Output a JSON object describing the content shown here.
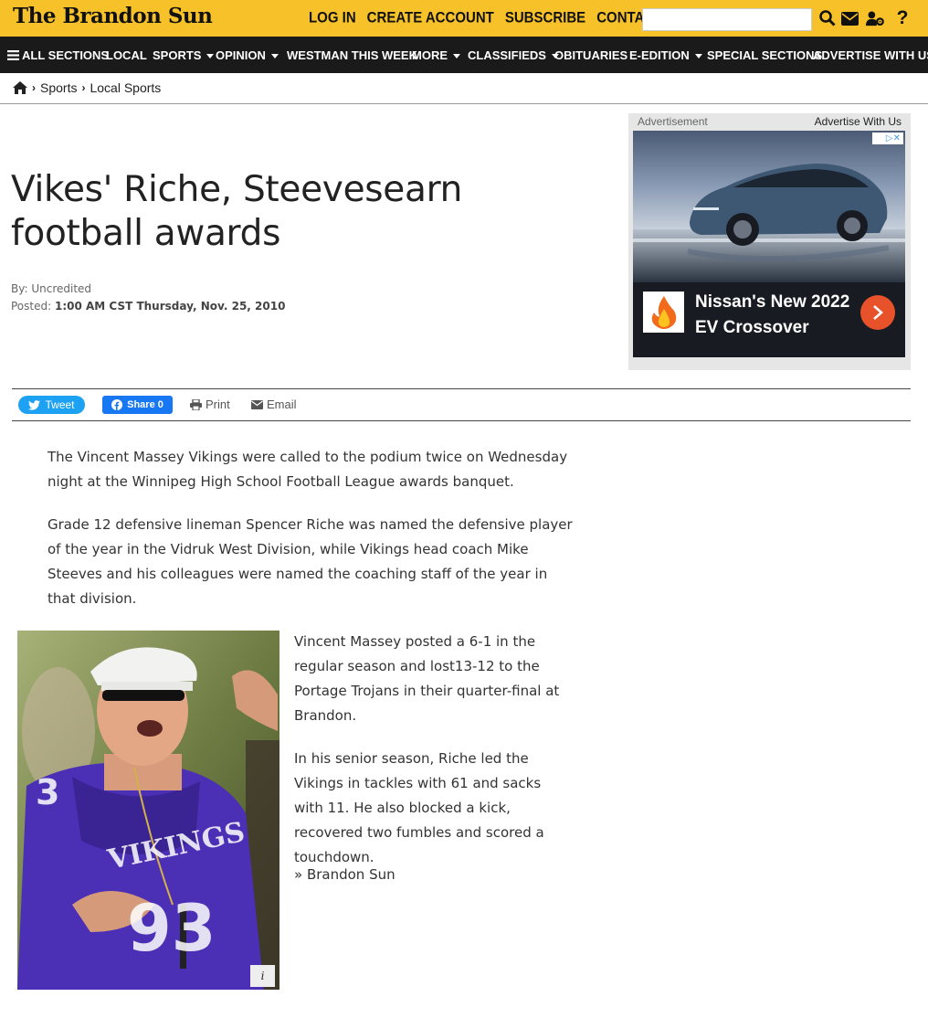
{
  "header": {
    "logo": "The Brandon Sun",
    "links": [
      "LOG IN",
      "CREATE ACCOUNT",
      "SUBSCRIBE",
      "CONTACT US"
    ],
    "search_placeholder": "",
    "icons": [
      "search-icon",
      "envelope-icon",
      "user-settings-icon",
      "help-icon"
    ]
  },
  "nav": {
    "items": [
      {
        "label": "ALL SECTIONS",
        "icon": "hamburger-icon"
      },
      {
        "label": "LOCAL"
      },
      {
        "label": "SPORTS",
        "dropdown": true
      },
      {
        "label": "OPINION",
        "dropdown": true
      },
      {
        "label": "WESTMAN THIS WEEK"
      },
      {
        "label": "MORE",
        "dropdown": true
      },
      {
        "label": "CLASSIFIEDS",
        "dropdown": true
      },
      {
        "label": "OBITUARIES"
      },
      {
        "label": "E-EDITION",
        "dropdown": true
      },
      {
        "label": "SPECIAL SECTIONS"
      },
      {
        "label": "ADVERTISE WITH US"
      }
    ]
  },
  "breadcrumb": {
    "items": [
      "Sports",
      "Local Sports"
    ],
    "home_icon": "home-icon"
  },
  "article": {
    "title": "Vikes' Riche, Steevesearn football awards",
    "byline_label": "By:",
    "byline": "Uncredited",
    "posted_label": "Posted:",
    "posted": "1:00 AM CST Thursday, Nov. 25, 2010",
    "paragraphs": [
      "The Vincent Massey Vikings were called to the podium twice on Wednesday night at the Winnipeg High School Football League awards banquet.",
      "Grade 12 defensive lineman Spencer Riche was named the defensive player of the year in the Vidruk West Division, while Vikings head coach Mike Steeves and his colleagues were named the coaching staff of the year in that division.",
      "Vincent Massey posted a 6-1 in the regular season and lost13-12 to the Portage Trojans in their quarter-final at Brandon.",
      "In his senior season, Riche led the Vikings in tackles with 61 and sacks with 11. He also blocked a kick, recovered two fumbles and scored a touchdown.",
      "» Brandon Sun"
    ],
    "photo_info": "i"
  },
  "share": {
    "tweet": "Tweet",
    "facebook": "Share 0",
    "print": "Print",
    "email": "Email"
  },
  "ad": {
    "label": "Advertisement",
    "advertise_link": "Advertise With Us",
    "title": "Nissan's New 2022 EV Crossover",
    "choices": "▷✕"
  },
  "colors": {
    "brand_yellow": "#f7c229",
    "nav_black": "#1a1a1a",
    "twitter_blue": "#1da1f2",
    "facebook_blue": "#1877f2",
    "ad_orange": "#e8522a"
  }
}
